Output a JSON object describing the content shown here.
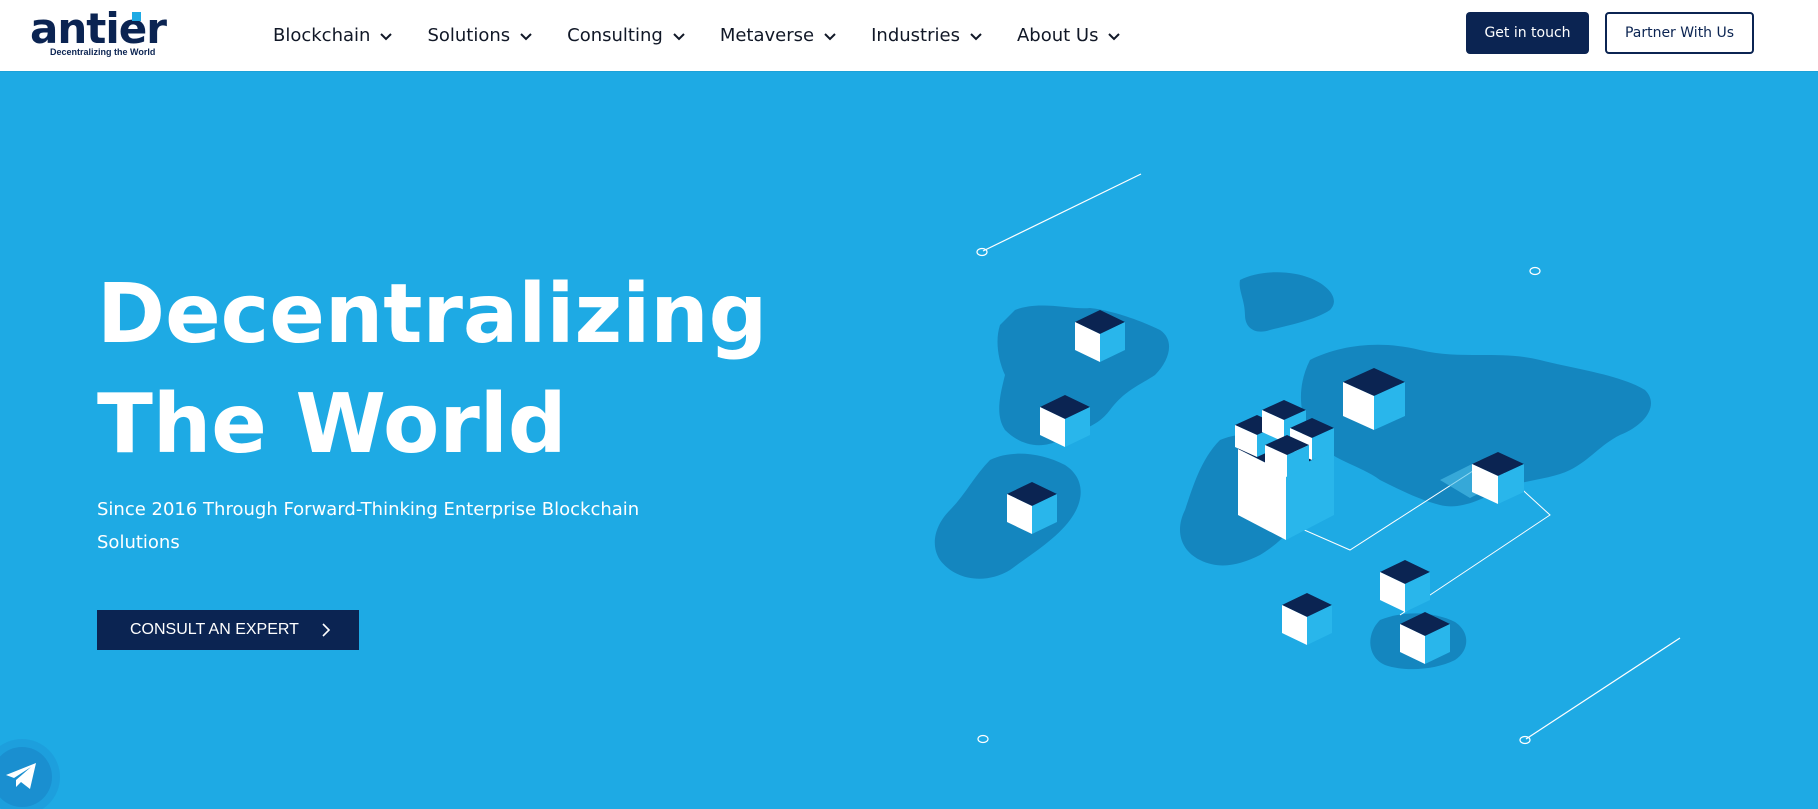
{
  "brand": {
    "name": "antier",
    "tagline": "Decentralizing the World"
  },
  "nav": {
    "items": [
      {
        "label": "Blockchain"
      },
      {
        "label": "Solutions"
      },
      {
        "label": "Consulting"
      },
      {
        "label": "Metaverse"
      },
      {
        "label": "Industries"
      },
      {
        "label": "About Us"
      }
    ]
  },
  "header_actions": {
    "get_in_touch": "Get in touch",
    "partner": "Partner With Us"
  },
  "hero": {
    "title_line1": "Decentralizing",
    "title_line2": "The World",
    "subtitle": "Since 2016 Through Forward-Thinking Enterprise Blockchain Solutions",
    "cta_label": "CONSULT AN EXPERT"
  },
  "colors": {
    "primary_bg": "#1eaae4",
    "navy": "#0b2452",
    "map": "#1486bf",
    "white": "#ffffff"
  },
  "icons": {
    "dropdown": "chevron-down-icon",
    "cta_arrow": "chevron-right-icon",
    "telegram": "telegram-icon"
  }
}
